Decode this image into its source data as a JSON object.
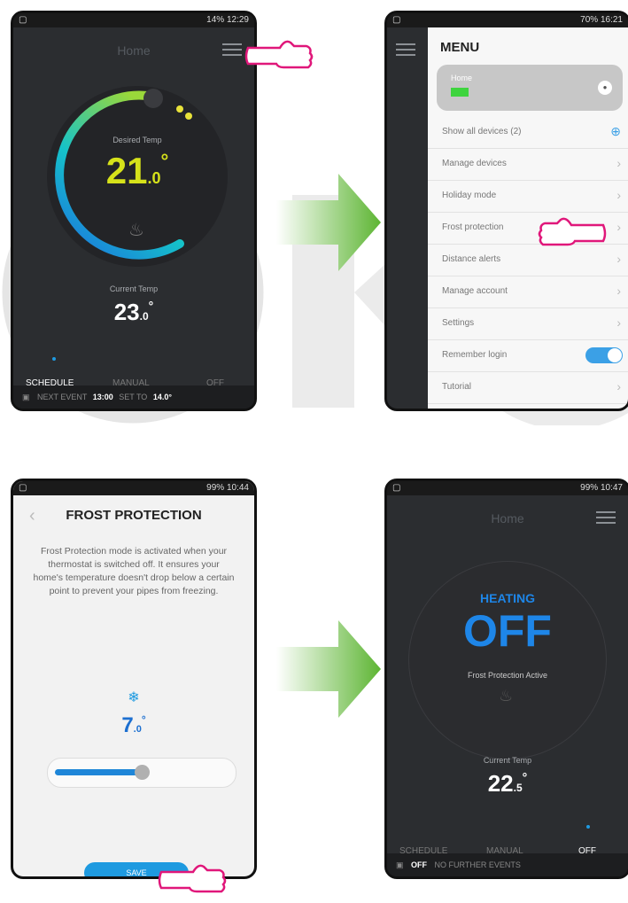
{
  "screen1": {
    "status_left": "□",
    "status_right": "14% 12:29",
    "title": "Home",
    "desired_label": "Desired Temp",
    "desired_int": "21",
    "desired_dec": ".0",
    "current_label": "Current Temp",
    "current_int": "23",
    "current_dec": ".0",
    "modes": [
      "SCHEDULE",
      "MANUAL",
      "OFF"
    ],
    "next_event_label": "NEXT EVENT",
    "next_event_time": "13:00",
    "set_to_label": "SET TO",
    "set_to_value": "14.0°"
  },
  "screen2": {
    "status_right": "70% 16:21",
    "menu_title": "MENU",
    "home_label": "Home",
    "items": [
      {
        "label": "Show all devices (2)"
      },
      {
        "label": "Manage devices"
      },
      {
        "label": "Holiday mode"
      },
      {
        "label": "Frost protection"
      },
      {
        "label": "Distance alerts"
      },
      {
        "label": "Manage account"
      },
      {
        "label": "Settings"
      },
      {
        "label": "Remember login"
      },
      {
        "label": "Tutorial"
      }
    ],
    "remember_login_on": true
  },
  "screen3": {
    "status_right": "99% 10:44",
    "title": "FROST PROTECTION",
    "description": "Frost Protection mode is activated when your thermostat is switched off. It ensures your home's temperature doesn't drop below a certain point to prevent your pipes from freezing.",
    "temp_int": "7",
    "temp_dec": ".0",
    "slider_fraction": 0.5,
    "save_label": "SAVE"
  },
  "screen4": {
    "status_right": "99% 10:47",
    "title": "Home",
    "heating_label": "HEATING",
    "state": "OFF",
    "frost_active": "Frost Protection Active",
    "current_label": "Current Temp",
    "current_int": "22",
    "current_dec": ".5",
    "modes": [
      "SCHEDULE",
      "MANUAL",
      "OFF"
    ],
    "bottom_state": "OFF",
    "bottom_events": "NO FURTHER EVENTS"
  },
  "colors": {
    "accent_blue": "#1e9ae0",
    "temp_yellow": "#d6e21a",
    "arrow_green": "#5db533",
    "hand_pink": "#e0177a"
  }
}
